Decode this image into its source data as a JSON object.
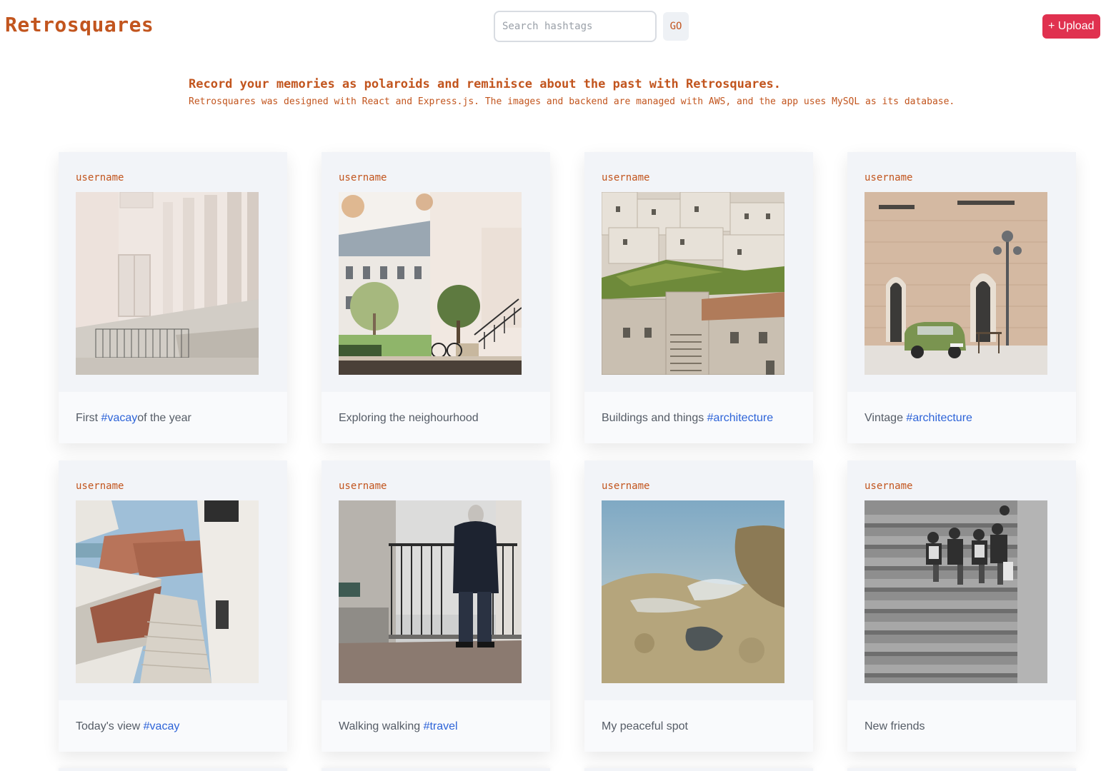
{
  "header": {
    "logo": "Retrosquares",
    "search_placeholder": "Search hashtags",
    "go_label": "GO",
    "upload_label": "+ Upload"
  },
  "intro": {
    "title": "Record your memories as polaroids and reminisce about the past with Retrosquares.",
    "description": "Retrosquares was designed with React and Express.js. The images and backend are managed with AWS, and the app uses MySQL as its database."
  },
  "colors": {
    "brand": "#c2551e",
    "upload": "#e0314f",
    "hashtag": "#2e64d8"
  },
  "posts": [
    {
      "username": "username",
      "caption_before": "First ",
      "hashtag": "#vacay",
      "caption_after": "of the year"
    },
    {
      "username": "username",
      "caption_before": "Exploring the neighourhood",
      "hashtag": "",
      "caption_after": ""
    },
    {
      "username": "username",
      "caption_before": "Buildings and things ",
      "hashtag": "#architecture",
      "caption_after": ""
    },
    {
      "username": "username",
      "caption_before": "Vintage ",
      "hashtag": "#architecture",
      "caption_after": ""
    },
    {
      "username": "username",
      "caption_before": "Today's view ",
      "hashtag": "#vacay",
      "caption_after": ""
    },
    {
      "username": "username",
      "caption_before": "Walking walking ",
      "hashtag": "#travel",
      "caption_after": ""
    },
    {
      "username": "username",
      "caption_before": "My peaceful spot",
      "hashtag": "",
      "caption_after": ""
    },
    {
      "username": "username",
      "caption_before": "New friends",
      "hashtag": "",
      "caption_after": ""
    }
  ]
}
